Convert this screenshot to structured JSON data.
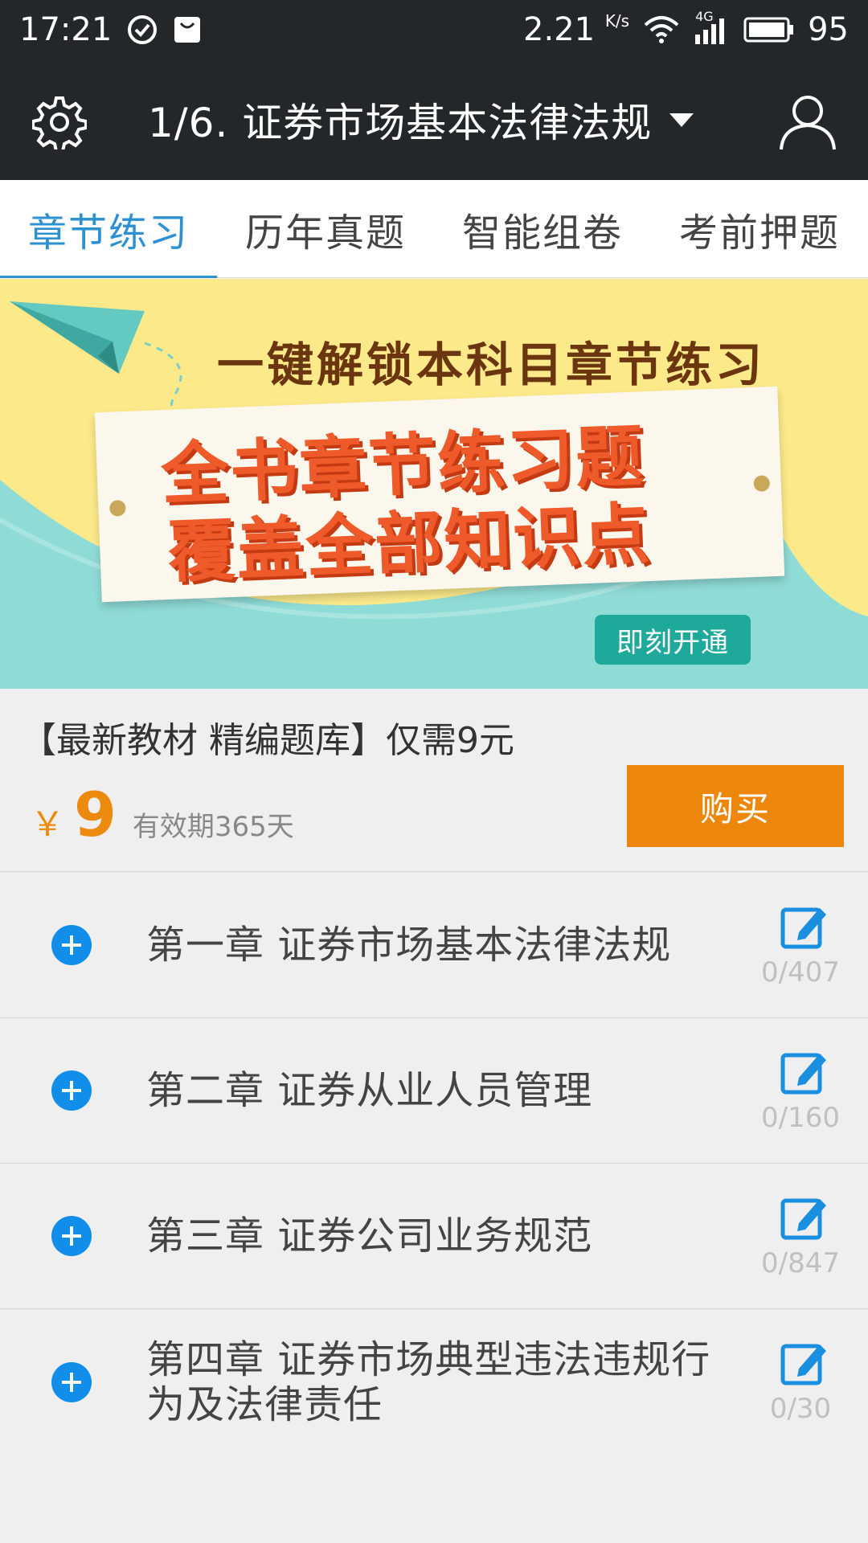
{
  "status_bar": {
    "time": "17:21",
    "net_speed": "2.21",
    "net_speed_unit": "K/s",
    "network_type": "4G",
    "battery": "95",
    "icons": [
      "check-circle-icon",
      "bag-icon",
      "wifi-icon",
      "signal-icon",
      "battery-icon"
    ]
  },
  "header": {
    "title": "1/6. 证券市场基本法律法规",
    "left_icon": "gear-icon",
    "right_icon": "user-icon",
    "dropdown_icon": "caret-down-icon"
  },
  "tabs": [
    {
      "label": "章节练习",
      "active": true
    },
    {
      "label": "历年真题",
      "active": false
    },
    {
      "label": "智能组卷",
      "active": false
    },
    {
      "label": "考前押题",
      "active": false
    }
  ],
  "banner": {
    "headline": "一键解锁本科目章节练习",
    "line1": "全书章节练习题",
    "line2": "覆盖全部知识点",
    "cta": "即刻开通",
    "icon": "paper-plane-icon"
  },
  "purchase": {
    "promo": "【最新教材 精编题库】仅需9元",
    "currency": "￥",
    "price": "9",
    "validity": "有效期365天",
    "buy_label": "购买"
  },
  "chapters": [
    {
      "title": "第一章 证券市场基本法律法规",
      "progress": "0/407"
    },
    {
      "title": "第二章 证券从业人员管理",
      "progress": "0/160"
    },
    {
      "title": "第三章 证券公司业务规范",
      "progress": "0/847"
    },
    {
      "title": "第四章 证券市场典型违法违规行为及法律责任",
      "progress": "0/30"
    }
  ],
  "colors": {
    "header_bg": "#232729",
    "accent_blue": "#2d90d2",
    "plus_blue": "#108ee9",
    "buy_orange": "#ec870c",
    "banner_yellow": "#fbe98a",
    "banner_teal": "#8fdbd6"
  }
}
